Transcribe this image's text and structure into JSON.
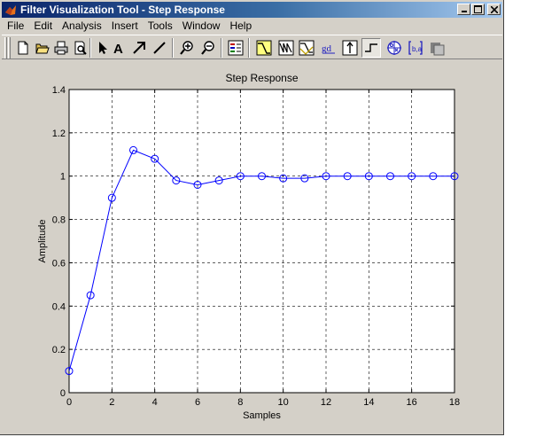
{
  "window": {
    "title": "Filter Visualization Tool - Step Response",
    "buttons": [
      "minimize",
      "maximize",
      "close"
    ]
  },
  "menu": [
    "File",
    "Edit",
    "Analysis",
    "Insert",
    "Tools",
    "Window",
    "Help"
  ],
  "toolbar": [
    {
      "name": "new-figure-icon",
      "group": 1
    },
    {
      "name": "open-icon",
      "group": 1
    },
    {
      "name": "print-icon",
      "group": 1
    },
    {
      "name": "print-preview-icon",
      "group": 1
    },
    {
      "name": "select-arrow-icon",
      "group": 2
    },
    {
      "name": "insert-text-icon",
      "group": 2
    },
    {
      "name": "insert-arrow-icon",
      "group": 2
    },
    {
      "name": "insert-line-icon",
      "group": 2
    },
    {
      "name": "zoom-in-icon",
      "group": 3
    },
    {
      "name": "zoom-out-icon",
      "group": 3
    },
    {
      "name": "legend-icon",
      "group": 4
    },
    {
      "name": "magnitude-response-icon",
      "group": 5
    },
    {
      "name": "phase-response-icon",
      "group": 5
    },
    {
      "name": "magnitude-phase-icon",
      "group": 5
    },
    {
      "name": "group-delay-icon",
      "group": 5
    },
    {
      "name": "impulse-response-icon",
      "group": 5
    },
    {
      "name": "step-response-icon",
      "group": 5,
      "pressed": true
    },
    {
      "name": "pole-zero-icon",
      "group": 5
    },
    {
      "name": "filter-coefficients-icon",
      "group": 5
    },
    {
      "name": "filter-info-icon",
      "group": 5
    }
  ],
  "chart_data": {
    "type": "line",
    "title": "Step Response",
    "xlabel": "Samples",
    "ylabel": "Amplitude",
    "xlim": [
      0,
      18
    ],
    "ylim": [
      0,
      1.4
    ],
    "xticks": [
      "0",
      "2",
      "4",
      "6",
      "8",
      "10",
      "12",
      "14",
      "16",
      "18"
    ],
    "yticks": [
      "0",
      "0.2",
      "0.4",
      "0.6",
      "0.8",
      "1",
      "1.2",
      "1.4"
    ],
    "grid": true,
    "marker": "circle",
    "color": "#0000ff",
    "x": [
      0,
      1,
      2,
      3,
      4,
      5,
      6,
      7,
      8,
      9,
      10,
      11,
      12,
      13,
      14,
      15,
      16,
      17,
      18
    ],
    "y": [
      0.1,
      0.45,
      0.9,
      1.12,
      1.08,
      0.98,
      0.96,
      0.98,
      1.0,
      1.0,
      0.99,
      0.99,
      1.0,
      1.0,
      1.0,
      1.0,
      1.0,
      1.0,
      1.0
    ]
  }
}
